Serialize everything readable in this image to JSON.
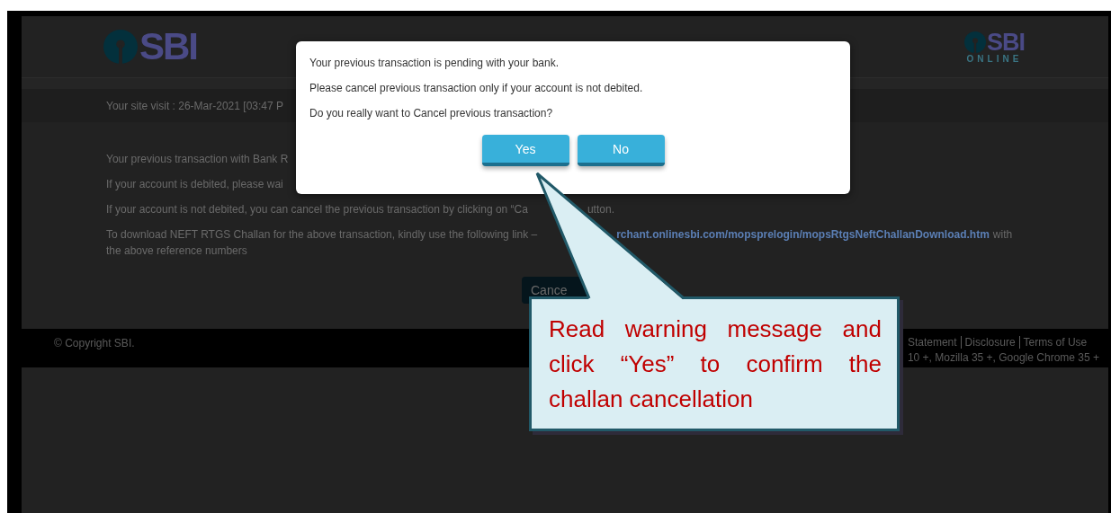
{
  "header": {
    "logo_text": "SBI",
    "online_logo": {
      "text": "SBI",
      "subtext": "ONLINE"
    }
  },
  "site_visit": "Your site visit : 26-Mar-2021 [03:47 P",
  "content": {
    "lines": [
      [
        {
          "kind": "text",
          "text": "Your previous transaction with Bank R"
        }
      ],
      [
        {
          "kind": "text",
          "text": "If your account is debited, please wai"
        }
      ],
      [
        {
          "kind": "text",
          "text": "If your account is not debited, you can cancel the previous transaction by clicking on “Ca"
        },
        {
          "kind": "text",
          "text": "utton."
        }
      ],
      [
        {
          "kind": "text",
          "text": "To download NEFT RTGS Challan for the above transaction, kindly use the following link –"
        },
        {
          "kind": "link",
          "text": "rchant.onlinesbi.com/mopsprelogin/mopsRtgsNeftChallanDownload.htm"
        },
        {
          "kind": "text",
          "text": "with"
        }
      ],
      [
        {
          "kind": "text",
          "text": "the above reference numbers"
        }
      ]
    ],
    "cancel_button": "Cance"
  },
  "footer": {
    "copyright": "© Copyright SBI.",
    "links": [
      "Statement",
      "Disclosure",
      "Terms of Use"
    ],
    "browser_note": "10 +, Mozilla 35 +, Google Chrome 35 +"
  },
  "dialog": {
    "messages": [
      "Your previous transaction is pending with your bank.",
      "Please cancel previous transaction only if your account is not debited.",
      "Do you really want to Cancel previous transaction?"
    ],
    "buttons": [
      "Yes",
      "No"
    ]
  },
  "callout": {
    "text": "Read warning message and click “Yes” to confirm the challan cancellation"
  }
}
